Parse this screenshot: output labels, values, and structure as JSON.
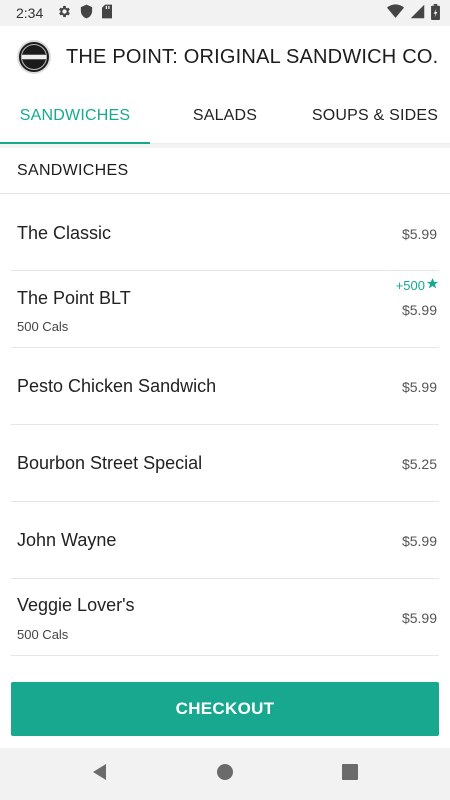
{
  "status_bar": {
    "time": "2:34",
    "left_icons": [
      "gear-icon",
      "shield-icon",
      "sd-card-icon"
    ],
    "right_icons": [
      "wifi-icon",
      "signal-icon",
      "battery-icon"
    ]
  },
  "header": {
    "title": "THE POINT: ORIGINAL SANDWICH CO.",
    "logo_icon": "the-point-logo"
  },
  "tabs": [
    {
      "label": "SANDWICHES",
      "active": true
    },
    {
      "label": "SALADS",
      "active": false
    },
    {
      "label": "SOUPS & SIDES",
      "active": false
    }
  ],
  "section": {
    "title": "SANDWICHES"
  },
  "items": [
    {
      "name": "The Classic",
      "price": "$5.99"
    },
    {
      "name": "The Point BLT",
      "price": "$5.99",
      "cals": "500 Cals",
      "bonus": "+500",
      "bonus_icon": "star-icon"
    },
    {
      "name": "Pesto Chicken Sandwich",
      "price": "$5.99"
    },
    {
      "name": "Bourbon Street Special",
      "price": "$5.25"
    },
    {
      "name": "John Wayne",
      "price": "$5.99"
    },
    {
      "name": "Veggie Lover's",
      "price": "$5.99",
      "cals": "500 Cals"
    }
  ],
  "checkout": {
    "label": "CHECKOUT"
  },
  "nav": {
    "icons": [
      "back-icon",
      "home-icon",
      "recents-icon"
    ]
  },
  "colors": {
    "accent": "#17a98f",
    "checkout_bg": "#18a88f",
    "status_bar_bg": "#f2f2f2"
  }
}
